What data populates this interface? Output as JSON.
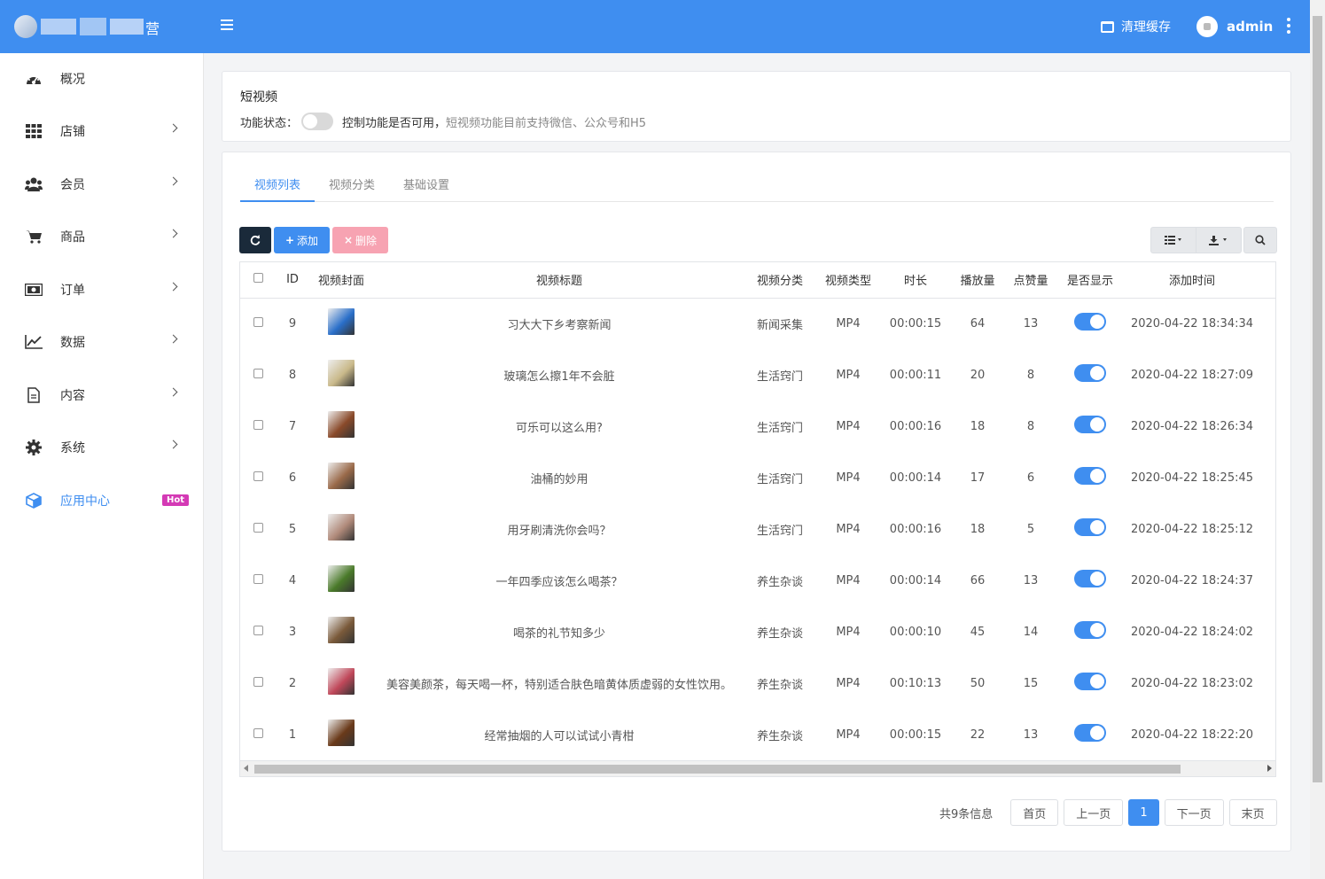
{
  "header": {
    "logo_text": "营",
    "clear_cache_label": "清理缓存",
    "username": "admin"
  },
  "sidebar": {
    "items": [
      {
        "label": "概况",
        "icon": "dashboard-icon",
        "has_arrow": false
      },
      {
        "label": "店铺",
        "icon": "grid-icon",
        "has_arrow": true
      },
      {
        "label": "会员",
        "icon": "users-icon",
        "has_arrow": true
      },
      {
        "label": "商品",
        "icon": "cart-icon",
        "has_arrow": true
      },
      {
        "label": "订单",
        "icon": "money-icon",
        "has_arrow": true
      },
      {
        "label": "数据",
        "icon": "line-chart-icon",
        "has_arrow": true
      },
      {
        "label": "内容",
        "icon": "document-icon",
        "has_arrow": true
      },
      {
        "label": "系统",
        "icon": "gear-icon",
        "has_arrow": true
      },
      {
        "label": "应用中心",
        "icon": "cube-icon",
        "has_arrow": false,
        "badge": "Hot",
        "active": true
      }
    ]
  },
  "feature": {
    "title": "短视频",
    "status_label": "功能状态：",
    "status_text": "控制功能是否可用，",
    "status_hint": "短视频功能目前支持微信、公众号和H5"
  },
  "tabs": [
    "视频列表",
    "视频分类",
    "基础设置"
  ],
  "toolbar": {
    "add_label": "添加",
    "delete_label": "删除"
  },
  "table": {
    "columns": [
      "ID",
      "视频封面",
      "视频标题",
      "视频分类",
      "视频类型",
      "时长",
      "播放量",
      "点赞量",
      "是否显示",
      "添加时间"
    ],
    "rows": [
      {
        "id": "9",
        "title": "习大大下乡考察新闻",
        "category": "新闻采集",
        "type": "MP4",
        "duration": "00:00:15",
        "plays": "64",
        "likes": "13",
        "time": "2020-04-22 18:34:34",
        "cover": "#2a6fc9"
      },
      {
        "id": "8",
        "title": "玻璃怎么擦1年不会脏",
        "category": "生活窍门",
        "type": "MP4",
        "duration": "00:00:11",
        "plays": "20",
        "likes": "8",
        "time": "2020-04-22 18:27:09",
        "cover": "#c9b98a"
      },
      {
        "id": "7",
        "title": "可乐可以这么用?",
        "category": "生活窍门",
        "type": "MP4",
        "duration": "00:00:16",
        "plays": "18",
        "likes": "8",
        "time": "2020-04-22 18:26:34",
        "cover": "#8a4a2a"
      },
      {
        "id": "6",
        "title": "油桶的妙用",
        "category": "生活窍门",
        "type": "MP4",
        "duration": "00:00:14",
        "plays": "17",
        "likes": "6",
        "time": "2020-04-22 18:25:45",
        "cover": "#9a6a4a"
      },
      {
        "id": "5",
        "title": "用牙刷清洗你会吗？",
        "category": "生活窍门",
        "type": "MP4",
        "duration": "00:00:16",
        "plays": "18",
        "likes": "5",
        "time": "2020-04-22 18:25:12",
        "cover": "#b08a7a"
      },
      {
        "id": "4",
        "title": "一年四季应该怎么喝茶？",
        "category": "养生杂谈",
        "type": "MP4",
        "duration": "00:00:14",
        "plays": "66",
        "likes": "13",
        "time": "2020-04-22 18:24:37",
        "cover": "#4a7a2a"
      },
      {
        "id": "3",
        "title": "喝茶的礼节知多少",
        "category": "养生杂谈",
        "type": "MP4",
        "duration": "00:00:10",
        "plays": "45",
        "likes": "14",
        "time": "2020-04-22 18:24:02",
        "cover": "#7a5a3a"
      },
      {
        "id": "2",
        "title": "美容美颜茶，每天喝一杯，特别适合肤色暗黄体质虚弱的女性饮用。",
        "category": "养生杂谈",
        "type": "MP4",
        "duration": "00:10:13",
        "plays": "50",
        "likes": "15",
        "time": "2020-04-22 18:23:02",
        "cover": "#c0485a"
      },
      {
        "id": "1",
        "title": "经常抽烟的人可以试试小青柑",
        "category": "养生杂谈",
        "type": "MP4",
        "duration": "00:00:15",
        "plays": "22",
        "likes": "13",
        "time": "2020-04-22 18:22:20",
        "cover": "#6a3a1a"
      }
    ]
  },
  "pagination": {
    "info": "共9条信息",
    "first": "首页",
    "prev": "上一页",
    "current": "1",
    "next": "下一页",
    "last": "末页"
  },
  "colors": {
    "primary": "#3f8ef0",
    "danger_light": "#f7a3b2",
    "dark": "#1a2a3a",
    "hot_badge": "#d43ab5"
  }
}
